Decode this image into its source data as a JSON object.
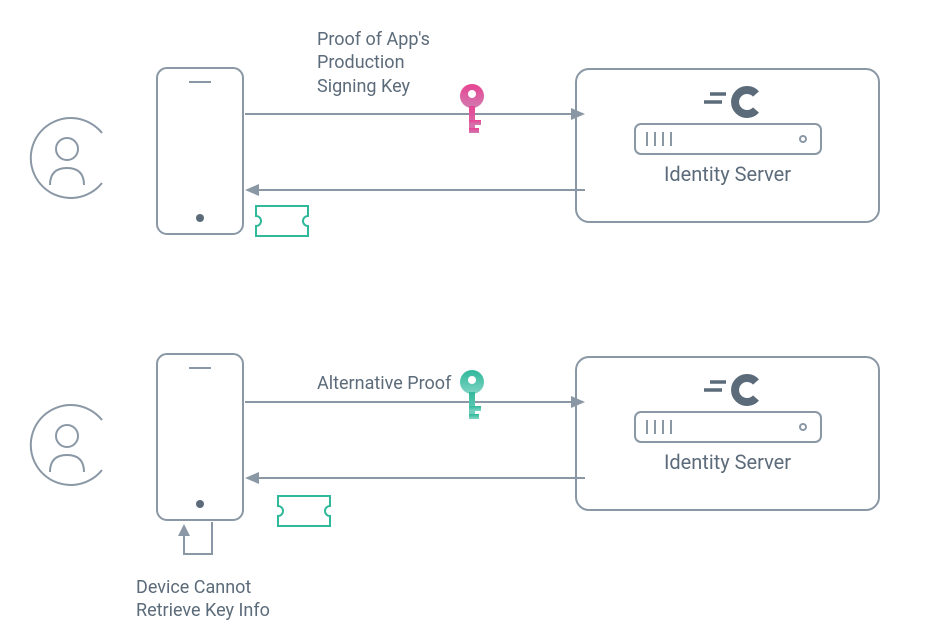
{
  "scene1": {
    "proof_label": "Proof of App's\nProduction\nSigning Key",
    "server_label": "Identity Server"
  },
  "scene2": {
    "proof_label": "Alternative Proof",
    "server_label": "Identity Server",
    "device_note": "Device Cannot\nRetrieve Key Info"
  },
  "colors": {
    "stroke": "#8a97a5",
    "key_pink": "#e84393",
    "key_teal": "#2fb89a",
    "ticket": "#2fb89a"
  }
}
